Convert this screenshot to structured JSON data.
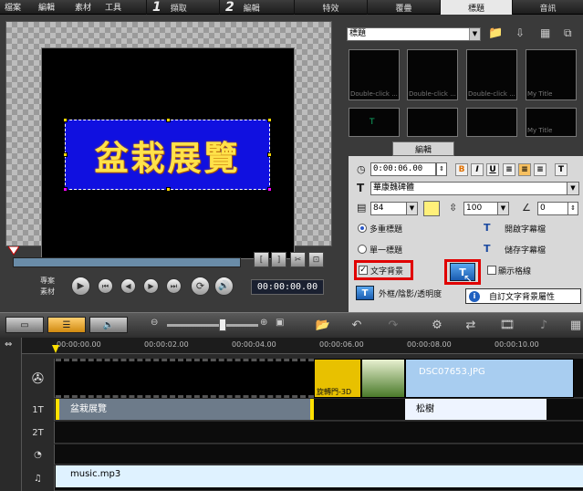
{
  "menu": [
    "檔案",
    "編輯",
    "素材",
    "工具"
  ],
  "steps": [
    {
      "num": "1",
      "label": "擷取"
    },
    {
      "num": "2",
      "label": "編輯"
    }
  ],
  "tabs": [
    {
      "label": "特效"
    },
    {
      "label": "覆疊"
    },
    {
      "label": "標題",
      "active": true
    },
    {
      "label": "音訊"
    }
  ],
  "preview": {
    "title_text": "盆栽展覽",
    "project_label": "專案",
    "clip_label": "素材",
    "timecode": "00:00:00.00"
  },
  "library": {
    "selected": "標題",
    "thumbs": [
      {
        "caption": "Double-click ...",
        "glyph": ""
      },
      {
        "caption": "Double-click ...",
        "glyph": ""
      },
      {
        "caption": "Double-click ...",
        "glyph": ""
      },
      {
        "caption": "My Title",
        "glyph": ""
      },
      {
        "caption": "",
        "glyph": "T"
      },
      {
        "caption": "",
        "glyph": ""
      },
      {
        "caption": "",
        "glyph": ""
      },
      {
        "caption": "My Title",
        "glyph": ""
      }
    ]
  },
  "edit_panel": {
    "tab_label": "編輯",
    "duration": "0:00:06.00",
    "font_name": "華康魏碑體",
    "font_size": "84",
    "line_spacing": "100",
    "rotation": "0",
    "multi_title": "多重標題",
    "single_title": "單一標題",
    "open_subtitle": "開啟字幕檔",
    "save_subtitle": "儲存字幕檔",
    "text_background": "文字背景",
    "show_grid": "顯示格線",
    "border_shadow": "外框/陰影/透明度",
    "tooltip": "自訂文字背景屬性"
  },
  "timeline": {
    "ruler": [
      "00:00:00.00",
      "00:00:02.00",
      "00:00:04.00",
      "00:00:06.00",
      "00:00:08.00",
      "00:00:10.00"
    ],
    "video_clips": [
      {
        "label": "旋轉門-3D"
      },
      {
        "label": ""
      },
      {
        "label": "DSC07653.JPG"
      }
    ],
    "title1_clips": [
      {
        "label": "盆栽展覽"
      },
      {
        "label": "松樹"
      }
    ],
    "track_labels": [
      "1T",
      "2T",
      "♫"
    ],
    "music_clip": "music.mp3"
  },
  "colors": {
    "accent_red": "#e00000",
    "title_bg": "#1010e0",
    "title_text": "#ffe24a"
  }
}
